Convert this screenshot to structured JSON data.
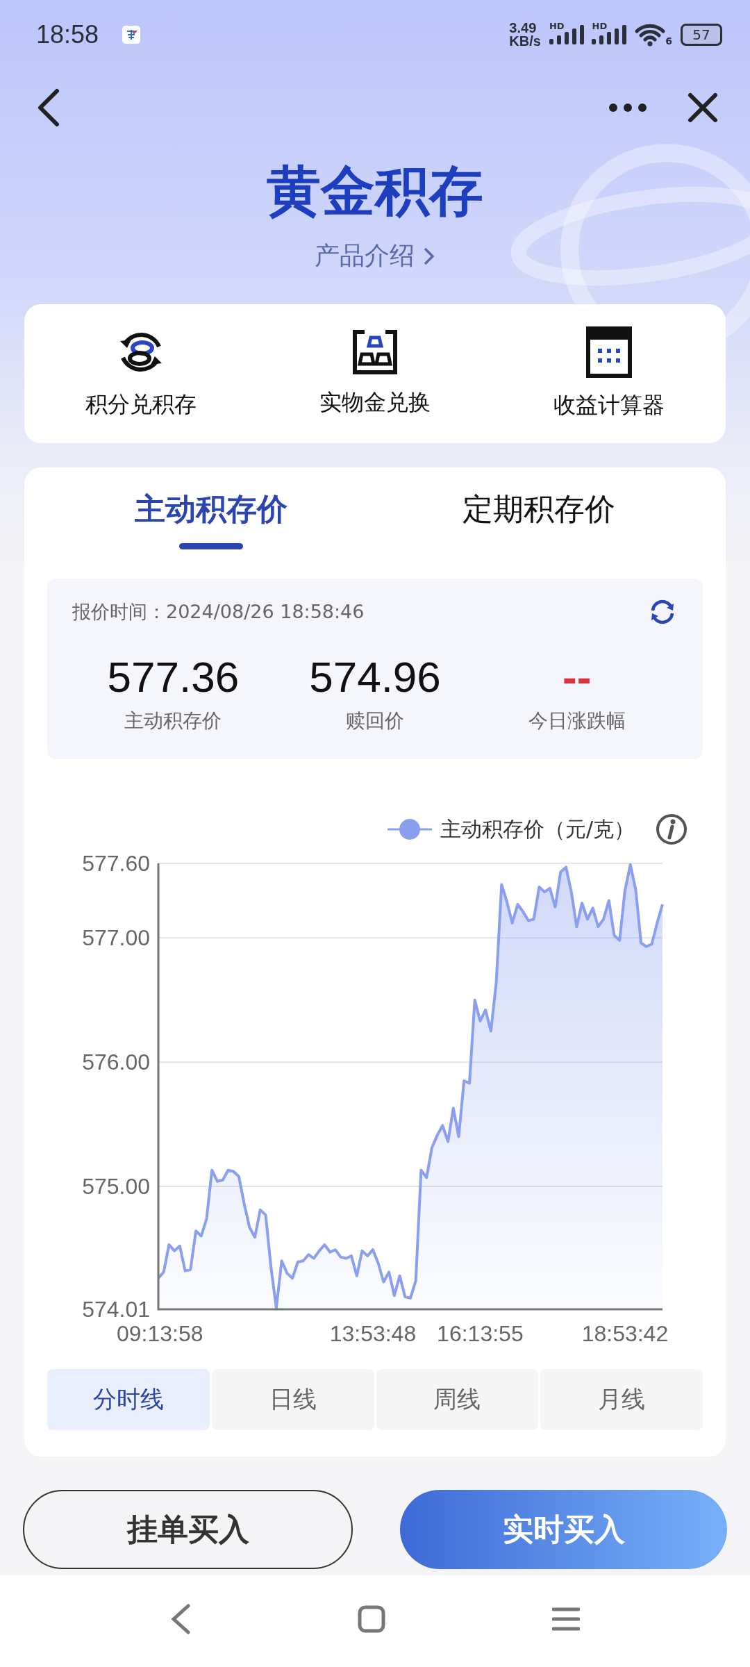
{
  "status_bar": {
    "time": "18:58",
    "net_speed": "3.49",
    "net_unit": "KB/s",
    "signal_labels": [
      "HD",
      "HD"
    ],
    "wifi_label": "6",
    "battery": "57"
  },
  "header": {
    "title": "黄金积存",
    "intro_link": "产品介绍"
  },
  "shortcuts": [
    {
      "label": "积分兑积存",
      "kind": "exchange"
    },
    {
      "label": "实物金兑换",
      "kind": "bars"
    },
    {
      "label": "收益计算器",
      "kind": "calculator"
    }
  ],
  "tabs": [
    {
      "label": "主动积存价",
      "selected": true
    },
    {
      "label": "定期积存价",
      "selected": false
    }
  ],
  "quote": {
    "time_label": "报价时间：2024/08/26 18:58:46",
    "items": [
      {
        "value": "577.36",
        "label": "主动积存价",
        "kind": "price"
      },
      {
        "value": "574.96",
        "label": "赎回价",
        "kind": "price"
      },
      {
        "value": "--",
        "label": "今日涨跌幅",
        "kind": "change"
      }
    ]
  },
  "chart": {
    "chart_data": {
      "type": "area",
      "grid": true,
      "ylim": [
        574.01,
        577.6
      ],
      "yticks": [
        {
          "value": 574.01,
          "label": "574.01"
        },
        {
          "value": 575,
          "label": "575.00"
        },
        {
          "value": 576,
          "label": "576.00"
        },
        {
          "value": 577,
          "label": "577.00"
        },
        {
          "value": 577.6,
          "label": "577.60"
        }
      ],
      "categories": [
        "09:13:58",
        null,
        null,
        null,
        null,
        null,
        null,
        null,
        null,
        null,
        null,
        null,
        null,
        null,
        null,
        null,
        null,
        null,
        null,
        null,
        null,
        null,
        null,
        null,
        null,
        null,
        null,
        null,
        null,
        null,
        null,
        null,
        null,
        null,
        null,
        null,
        null,
        null,
        null,
        null,
        "13:53:48",
        null,
        null,
        null,
        null,
        null,
        null,
        null,
        null,
        null,
        null,
        null,
        null,
        null,
        null,
        null,
        null,
        null,
        null,
        null,
        "16:13:55",
        null,
        null,
        null,
        null,
        null,
        null,
        null,
        null,
        null,
        null,
        null,
        null,
        null,
        null,
        null,
        null,
        null,
        null,
        null,
        null,
        null,
        null,
        null,
        null,
        null,
        null,
        "18:53:42",
        null,
        null,
        null,
        null,
        null,
        null,
        null
      ],
      "series": [
        {
          "name": "主动积存价（元/克）",
          "color": "#8a9ff0",
          "values": [
            574.26,
            574.31,
            574.53,
            574.48,
            574.52,
            574.32,
            574.33,
            574.64,
            574.6,
            574.74,
            575.13,
            575.04,
            575.05,
            575.13,
            575.12,
            575.08,
            574.86,
            574.67,
            574.59,
            574.81,
            574.77,
            574.35,
            574.02,
            574.4,
            574.3,
            574.26,
            574.39,
            574.4,
            574.45,
            574.42,
            574.48,
            574.53,
            574.47,
            574.49,
            574.43,
            574.42,
            574.44,
            574.28,
            574.48,
            574.44,
            574.49,
            574.38,
            574.23,
            574.31,
            574.12,
            574.28,
            574.11,
            574.1,
            574.24,
            575.13,
            575.07,
            575.31,
            575.41,
            575.49,
            575.36,
            575.63,
            575.4,
            575.85,
            575.83,
            576.5,
            576.33,
            576.42,
            576.25,
            576.64,
            577.43,
            577.29,
            577.12,
            577.27,
            577.21,
            577.14,
            577.15,
            577.41,
            577.37,
            577.4,
            577.25,
            577.53,
            577.57,
            577.37,
            577.09,
            577.28,
            577.15,
            577.24,
            577.09,
            577.15,
            577.3,
            577.02,
            576.98,
            577.38,
            577.59,
            577.39,
            576.96,
            576.93,
            576.95,
            577.12,
            577.27
          ]
        }
      ]
    }
  },
  "periods": [
    {
      "label": "分时线",
      "selected": true
    },
    {
      "label": "日线",
      "selected": false
    },
    {
      "label": "周线",
      "selected": false
    },
    {
      "label": "月线",
      "selected": false
    }
  ],
  "actions": [
    {
      "label": "挂单买入",
      "kind": "outline"
    },
    {
      "label": "实时买入",
      "kind": "primary"
    }
  ]
}
